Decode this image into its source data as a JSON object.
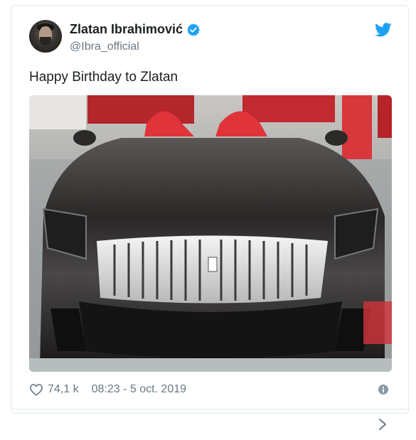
{
  "tweet": {
    "author_name": "Zlatan Ibrahimović",
    "handle": "@Ibra_official",
    "text": "Happy Birthday to Zlatan",
    "likes": "74,1 k",
    "timestamp": "08:23 - 5 oct. 2019"
  },
  "media": {
    "description_icon": "car-photo"
  },
  "icons": {
    "verified": "verified-badge-icon",
    "twitter": "twitter-bird-icon",
    "like": "heart-icon",
    "info": "info-icon",
    "next": "chevron-right-icon"
  },
  "colors": {
    "accent": "#1da1f2",
    "text": "#1c2022",
    "muted": "#697882",
    "border": "#e1e8ed"
  }
}
